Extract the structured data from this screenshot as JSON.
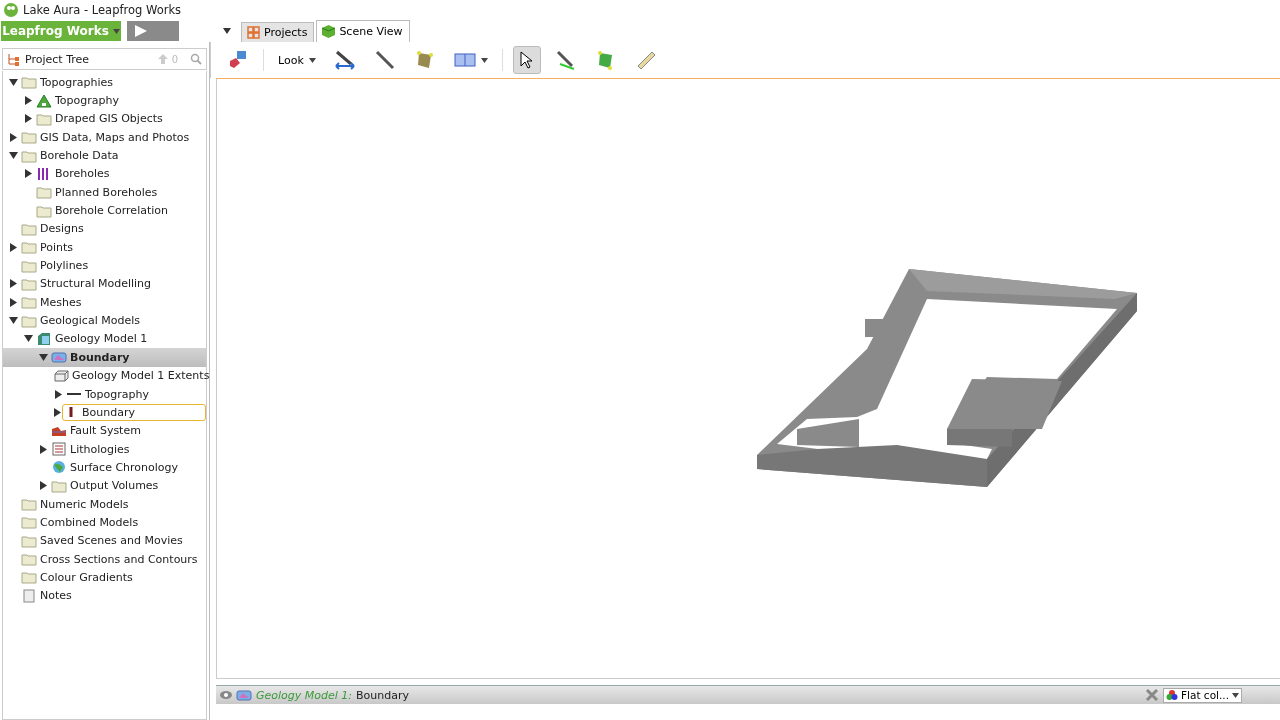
{
  "window": {
    "title": "Lake Aura - Leapfrog Works"
  },
  "app_menu": {
    "label": "Leapfrog Works"
  },
  "tabs": [
    {
      "label": "Projects",
      "selected": false,
      "kind": "grid"
    },
    {
      "label": "Scene View",
      "selected": true,
      "kind": "cube"
    }
  ],
  "toolbar": {
    "look_label": "Look",
    "pointer_selected": true
  },
  "project_tree": {
    "title": "Project Tree",
    "count": "0",
    "items": [
      {
        "label": "Topographies",
        "kind": "folder",
        "expanded": true,
        "selected": false,
        "outlined": false,
        "children": [
          {
            "label": "Topography",
            "kind": "topography",
            "expanded": false,
            "selected": false,
            "outlined": false
          },
          {
            "label": "Draped GIS Objects",
            "kind": "folder",
            "expanded": false,
            "selected": false,
            "outlined": false
          }
        ]
      },
      {
        "label": "GIS Data, Maps and Photos",
        "kind": "folder",
        "expanded": false,
        "selected": false,
        "outlined": false
      },
      {
        "label": "Borehole Data",
        "kind": "folder",
        "expanded": true,
        "selected": false,
        "outlined": false,
        "children": [
          {
            "label": "Boreholes",
            "kind": "boreholes",
            "expanded": false,
            "selected": false,
            "outlined": false
          },
          {
            "label": "Planned Boreholes",
            "kind": "folder",
            "selected": false,
            "outlined": false
          },
          {
            "label": "Borehole Correlation",
            "kind": "folder",
            "selected": false,
            "outlined": false
          }
        ]
      },
      {
        "label": "Designs",
        "kind": "folder",
        "selected": false,
        "outlined": false
      },
      {
        "label": "Points",
        "kind": "folder",
        "expanded": false,
        "selected": false,
        "outlined": false
      },
      {
        "label": "Polylines",
        "kind": "folder",
        "selected": false,
        "outlined": false
      },
      {
        "label": "Structural Modelling",
        "kind": "folder",
        "expanded": false,
        "selected": false,
        "outlined": false
      },
      {
        "label": "Meshes",
        "kind": "folder",
        "expanded": false,
        "selected": false,
        "outlined": false
      },
      {
        "label": "Geological Models",
        "kind": "folder",
        "expanded": true,
        "selected": false,
        "outlined": false,
        "children": [
          {
            "label": "Geology Model 1",
            "kind": "geomodel",
            "expanded": true,
            "selected": false,
            "outlined": false,
            "children": [
              {
                "label": "Boundary",
                "kind": "boundary",
                "expanded": true,
                "selected": true,
                "outlined": false,
                "children": [
                  {
                    "label": "Geology Model 1 Extents",
                    "kind": "extents",
                    "selected": false,
                    "outlined": false
                  },
                  {
                    "label": "Topography",
                    "kind": "line",
                    "expanded": false,
                    "selected": false,
                    "outlined": false
                  },
                  {
                    "label": "Boundary",
                    "kind": "boundaryline",
                    "expanded": false,
                    "selected": false,
                    "outlined": true
                  }
                ]
              },
              {
                "label": "Fault System",
                "kind": "fault",
                "selected": false,
                "outlined": false
              },
              {
                "label": "Lithologies",
                "kind": "lithologies",
                "expanded": false,
                "selected": false,
                "outlined": false
              },
              {
                "label": "Surface Chronology",
                "kind": "chronology",
                "selected": false,
                "outlined": false
              },
              {
                "label": "Output Volumes",
                "kind": "folder",
                "expanded": false,
                "selected": false,
                "outlined": false
              }
            ]
          }
        ]
      },
      {
        "label": "Numeric Models",
        "kind": "folder",
        "selected": false,
        "outlined": false
      },
      {
        "label": "Combined Models",
        "kind": "folder",
        "selected": false,
        "outlined": false
      },
      {
        "label": "Saved Scenes and Movies",
        "kind": "folder",
        "selected": false,
        "outlined": false
      },
      {
        "label": "Cross Sections and Contours",
        "kind": "folder",
        "selected": false,
        "outlined": false
      },
      {
        "label": "Colour Gradients",
        "kind": "folder",
        "selected": false,
        "outlined": false
      },
      {
        "label": "Notes",
        "kind": "notes",
        "selected": false,
        "outlined": false
      }
    ]
  },
  "shape_list": {
    "model": "Geology Model 1",
    "separator": ":",
    "object": "Boundary",
    "colour_mode": "Flat col..."
  }
}
